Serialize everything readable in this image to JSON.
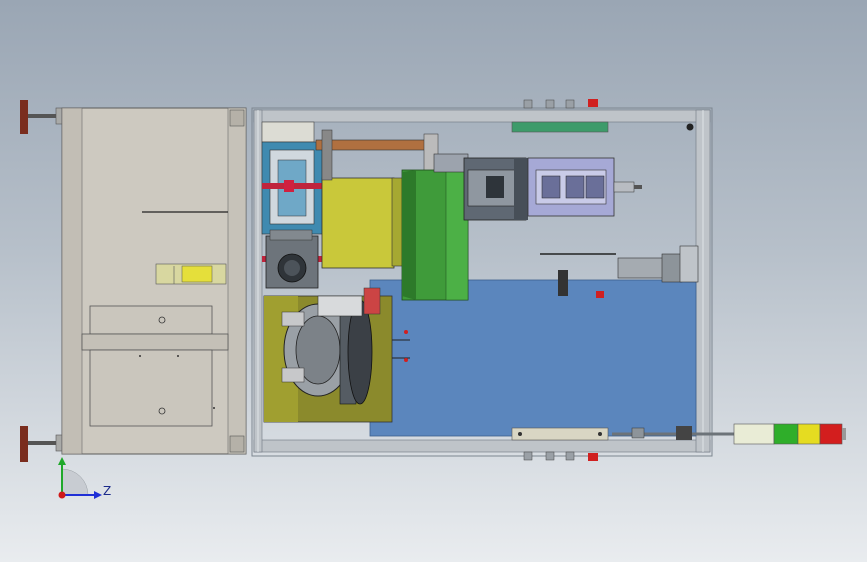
{
  "viewport": {
    "background_top": "#9aa6b4",
    "background_bottom": "#e9ecef"
  },
  "triad": {
    "z_label": "Z",
    "x_axis_color": "#1f2fd6",
    "y_axis_color": "#1fa82a",
    "origin_color": "#d01818"
  },
  "machine": {
    "left_enclosure_color": "#cdc9c0",
    "frame_color": "#bfc4c9",
    "base_plate_color": "#5b86bd",
    "rotary_table_color": "#8b8a2c",
    "feeder_color": "#c9c83a",
    "guard_green": "#3f9b3a",
    "signal_tower": [
      "#e9ecd6",
      "#2fae2a",
      "#e5dc21",
      "#d31e1e"
    ]
  }
}
